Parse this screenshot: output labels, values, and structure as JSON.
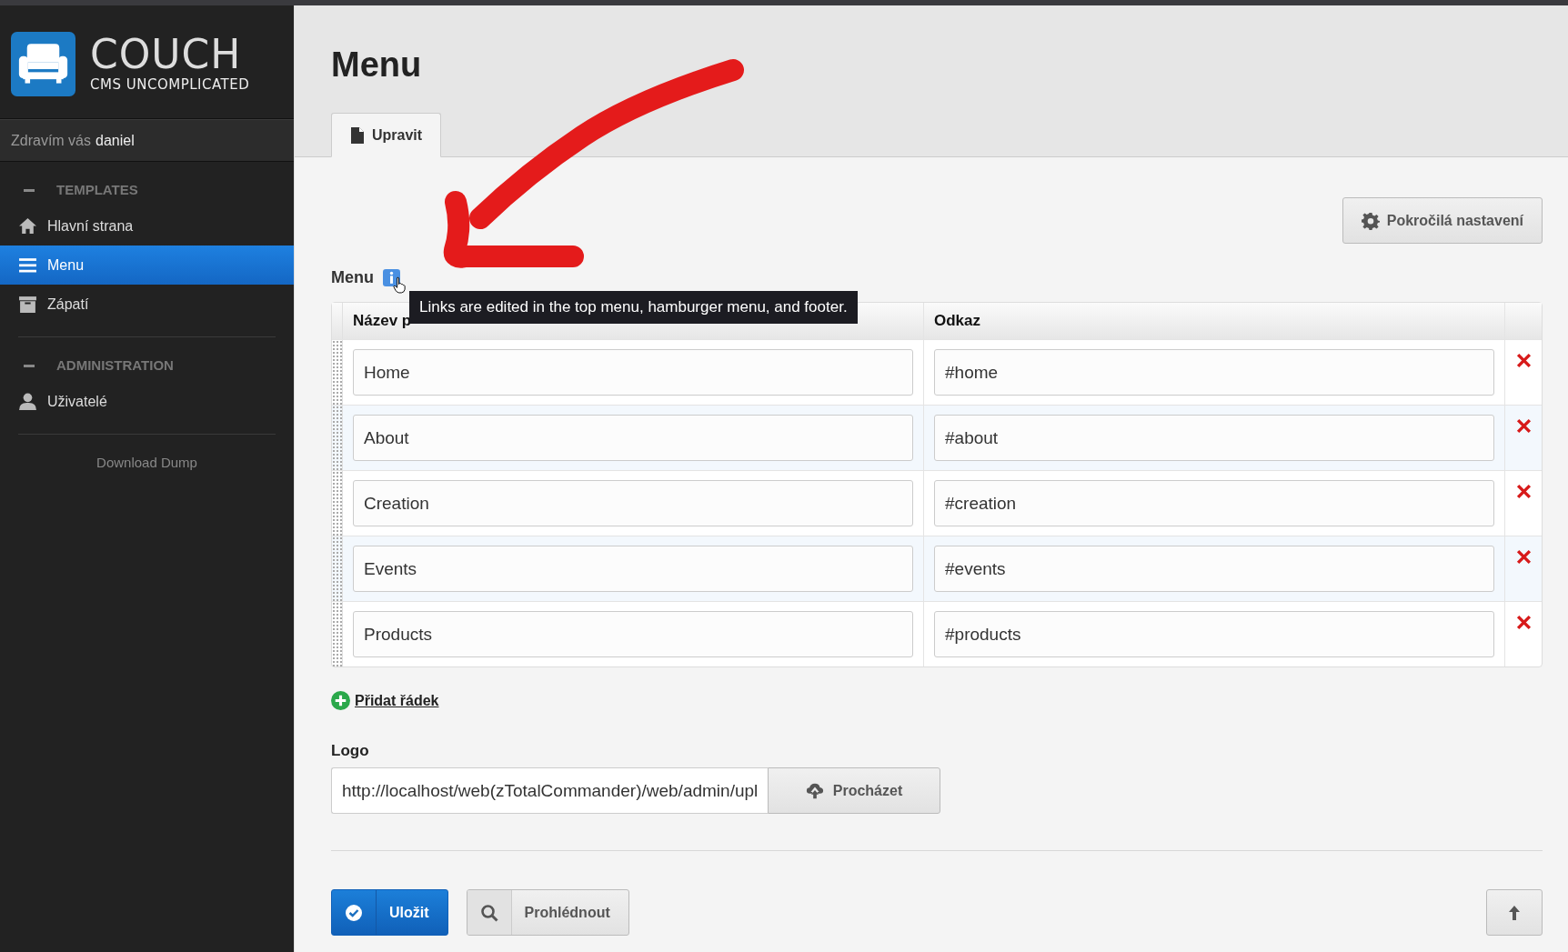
{
  "sidebar": {
    "logo": {
      "title": "COUCH",
      "subtitle": "CMS UNCOMPLICATED"
    },
    "greeting": "Zdravím vás",
    "user": "daniel",
    "sections": [
      {
        "title": "TEMPLATES",
        "expanded": true,
        "items": [
          {
            "label": "Hlavní strana",
            "kind": "home",
            "selected": false
          },
          {
            "label": "Menu",
            "kind": "menu",
            "selected": true
          },
          {
            "label": "Zápatí",
            "kind": "box",
            "selected": false
          }
        ]
      },
      {
        "title": "ADMINISTRATION",
        "expanded": true,
        "items": [
          {
            "label": "Uživatelé",
            "kind": "user",
            "selected": false
          }
        ]
      }
    ],
    "footer_link": "Download Dump"
  },
  "main": {
    "page_title": "Menu",
    "tabs": [
      {
        "label": "Upravit",
        "selected": true
      }
    ],
    "advanced_button": "Pokročilá nastavení",
    "field_label": "Menu",
    "tooltip": "Links are edited in the top menu, hamburger menu, and footer.",
    "table": {
      "columns": [
        "Název p",
        "Odkaz"
      ],
      "rows": [
        {
          "name": "Home",
          "link": "#home"
        },
        {
          "name": "About",
          "link": "#about"
        },
        {
          "name": "Creation",
          "link": "#creation"
        },
        {
          "name": "Events",
          "link": "#events"
        },
        {
          "name": "Products",
          "link": "#products"
        }
      ]
    },
    "add_row": "Přidat řádek",
    "logo_field": {
      "label": "Logo",
      "value": "http://localhost/web(zTotalCommander)/web/admin/upl",
      "button": "Procházet"
    },
    "save_button": "Uložit",
    "preview_button": "Prohlédnout"
  }
}
